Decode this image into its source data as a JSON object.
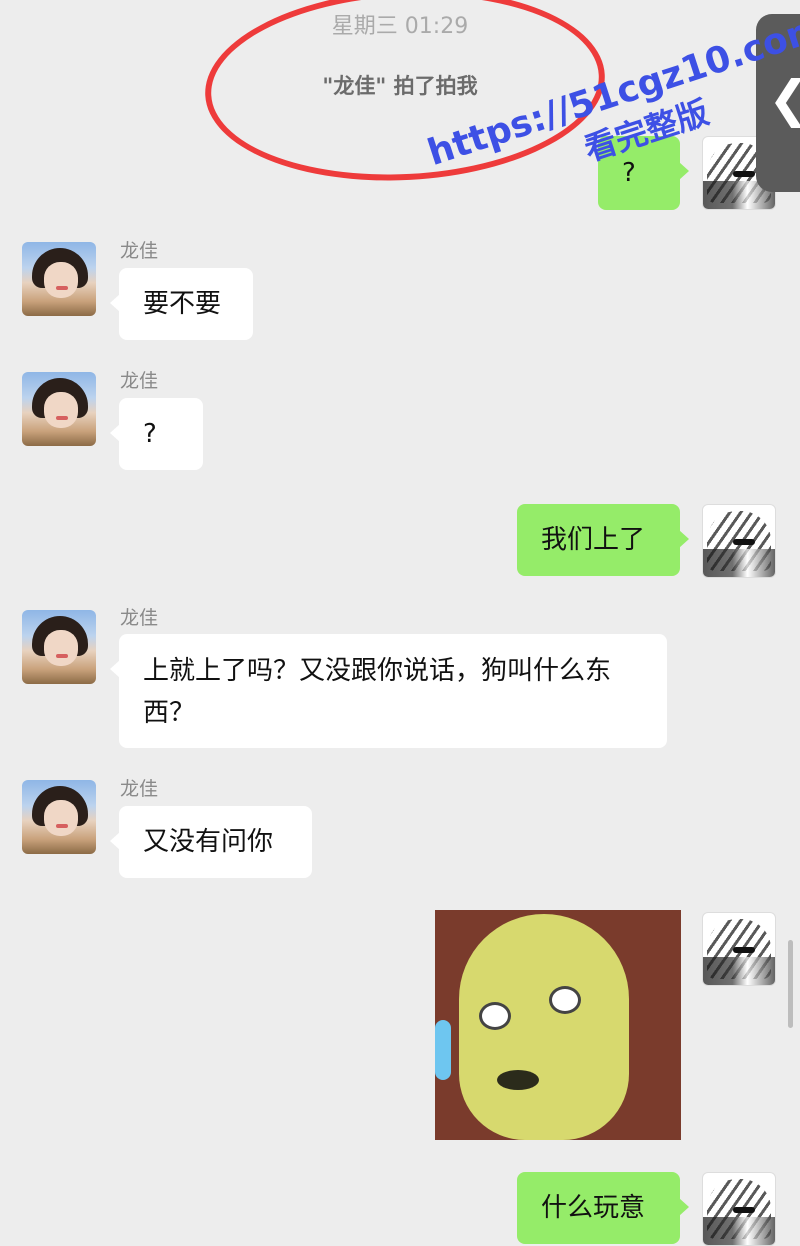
{
  "header": {
    "timestamp": "星期三 01:29",
    "system_message": "\"龙佳\" 拍了拍我"
  },
  "watermark": {
    "line1": "https://51cgz10.com",
    "line2": "看完整版"
  },
  "side_handle": {
    "icon": "chevron-left-icon",
    "glyph": "❮"
  },
  "messages": [
    {
      "from": "me",
      "type": "text",
      "text": "?"
    },
    {
      "from": "other",
      "sender": "龙佳",
      "type": "text",
      "text": "要不要"
    },
    {
      "from": "other",
      "sender": "龙佳",
      "type": "text",
      "text": "?"
    },
    {
      "from": "me",
      "type": "text",
      "text": "我们上了"
    },
    {
      "from": "other",
      "sender": "龙佳",
      "type": "text",
      "text": "上就上了吗？又没跟你说话，狗叫什么东西？"
    },
    {
      "from": "other",
      "sender": "龙佳",
      "type": "text",
      "text": "又没有问你"
    },
    {
      "from": "me",
      "type": "sticker",
      "icon": "yellow-face-sticker"
    },
    {
      "from": "me",
      "type": "text",
      "text": "什么玩意"
    }
  ],
  "colors": {
    "background": "#ededed",
    "my_bubble": "#95ec69",
    "their_bubble": "#ffffff",
    "annotation_circle": "#ee3b3b",
    "watermark": "#3d50e5"
  }
}
